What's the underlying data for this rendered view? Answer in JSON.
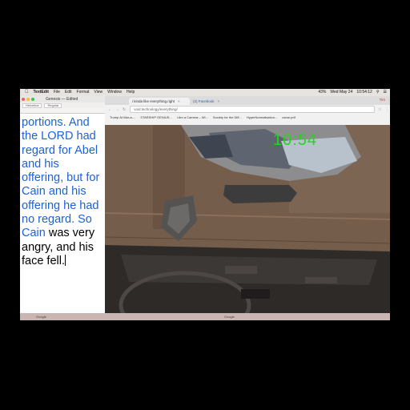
{
  "menubar": {
    "apple": "",
    "items": [
      "TextEdit",
      "File",
      "Edit",
      "Format",
      "View",
      "Window",
      "Help"
    ],
    "right": [
      "Wed May 24",
      "10:54:12",
      "43%"
    ]
  },
  "textedit": {
    "title": "Genesis — Edited",
    "font_family": "Helvetica",
    "font_style": "Regular",
    "text_black_1": "portions. And the LORD had regard for Abel and his offering, but for Cain and his offering he had no regard. So Cain",
    "text_blue": "",
    "text_black_2": " was very angry, and his face fell."
  },
  "browser": {
    "tabs": [
      {
        "title": "i kinda like everything.right",
        "active": true
      },
      {
        "title": "(2) Facebook",
        "active": false
      }
    ],
    "profile": "Tim",
    "url": "void.technology/everything/",
    "bookmarks": [
      "Trump At Mar-a-...",
      "STARSHIP GENIUS...",
      "I Am a Camera – Wi...",
      "Society for the Diff...",
      "HyperNormalisation...",
      "carse.pdf"
    ]
  },
  "scene": {
    "clock": "10:54"
  },
  "taskbar": {
    "items": [
      "Google",
      "Google"
    ]
  }
}
